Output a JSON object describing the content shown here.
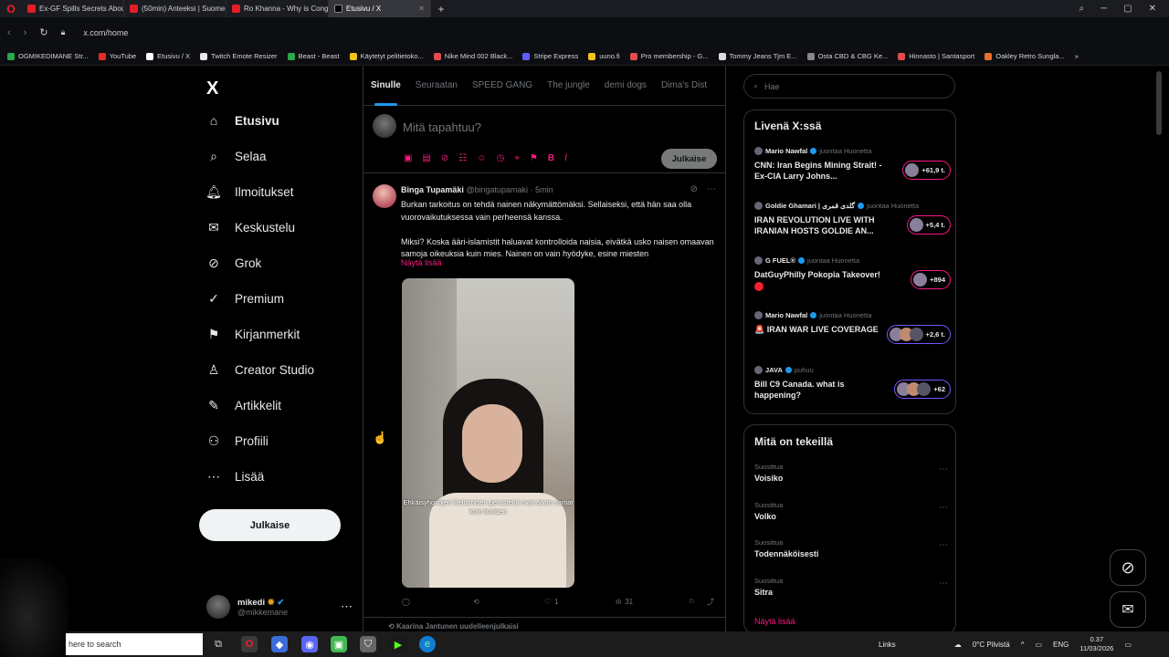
{
  "browser": {
    "tabs": [
      {
        "label": "Ex-GF Spills Secrets About"
      },
      {
        "label": "(50min) Anteeksi | Suome"
      },
      {
        "label": "Ro Khanna - Why is Cong"
      },
      {
        "label": "Etusivu / X"
      }
    ],
    "url": "x.com/home",
    "ai_label": "AI",
    "bookmarks": [
      {
        "label": "OGMIKEDIMANE Str...",
        "color": "#2aa84a"
      },
      {
        "label": "YouTube",
        "color": "#e52d27"
      },
      {
        "label": "Etusivu / X",
        "color": "#ffffff"
      },
      {
        "label": "Twitch Emote Resizer",
        "color": "#e8e8e8"
      },
      {
        "label": "Beast - Beast",
        "color": "#2aa84a"
      },
      {
        "label": "Käytetyt pelitietoko...",
        "color": "#f0c419"
      },
      {
        "label": "Nike Mind 002 Black...",
        "color": "#e54b4b"
      },
      {
        "label": "Stripe Express",
        "color": "#635bff"
      },
      {
        "label": "uuno.fi",
        "color": "#f0c419"
      },
      {
        "label": "Pro membership - G...",
        "color": "#e54b4b"
      },
      {
        "label": "Tommy Jeans Tjm E...",
        "color": "#dddddd"
      },
      {
        "label": "Osta CBD & CBG Ke...",
        "color": "#888888"
      },
      {
        "label": "Hinnasto | Santasport",
        "color": "#e54b4b"
      },
      {
        "label": "Oakley Retro Sungla...",
        "color": "#e8702a"
      }
    ]
  },
  "nav": {
    "logo": "X",
    "items": [
      {
        "label": "Etusivu",
        "icon": "⌂"
      },
      {
        "label": "Selaa",
        "icon": "⌕"
      },
      {
        "label": "Ilmoitukset",
        "icon": "🔔︎"
      },
      {
        "label": "Keskustelu",
        "icon": "✉︎"
      },
      {
        "label": "Grok",
        "icon": "⊘"
      },
      {
        "label": "Premium",
        "icon": "✓"
      },
      {
        "label": "Kirjanmerkit",
        "icon": "⚑"
      },
      {
        "label": "Creator Studio",
        "icon": "♙"
      },
      {
        "label": "Artikkelit",
        "icon": "✎"
      },
      {
        "label": "Profiili",
        "icon": "⚇"
      },
      {
        "label": "Lisää",
        "icon": "⋯"
      }
    ],
    "post_button": "Julkaise",
    "user": {
      "name": "mikedi",
      "handle": "@mikkemane"
    }
  },
  "feed": {
    "tabs": [
      "Sinulle",
      "Seuraatan",
      "SPEED GANG",
      "The jungle",
      "demi dogs",
      "Dima's Dist"
    ],
    "composer": {
      "placeholder": "Mitä tapahtuu?",
      "publish": "Julkaise"
    },
    "tweet": {
      "author": "Binga Tupamäki",
      "handle_time": "@bingatupamaki · 5min",
      "para1": "Burkan tarkoitus on tehdä nainen näkymättömäksi. Sellaiseksi, että hän saa olla vuorovaikutuksessa vain perheensä kanssa.",
      "para2": "Miksi? Koska ääri-islamistit haluavat kontrolloida naisia, eivätkä usko naisen omaavan samoja oikeuksia kuin mies. Nainen on vain hyödyke, esine miesten",
      "show_more": "Näytä lisää",
      "video_caption": "Ehkäisyhoitojen kieltämisen perustelut ovat aivan samat kuin burkien",
      "replies": "",
      "reposts": "",
      "likes": "1",
      "views": "31"
    },
    "next_retweet": "Kaarina Jantunen uudelleenjulkaisi"
  },
  "sidebar": {
    "search_placeholder": "Hae",
    "live_title": "Livenä X:ssä",
    "live": [
      {
        "user": "Mario Nawfal",
        "meta": "juontaa Huonetta",
        "title": "CNN: Iran Begins Mining Strait! - Ex-CIA Larry Johns...",
        "count": "+61,9 t.",
        "ring": "pink"
      },
      {
        "user": "Goldie Ghamari | گلدی قمری",
        "meta": "juontaa Huonetta",
        "title": "IRAN REVOLUTION LIVE WITH IRANIAN HOSTS GOLDIE AN...",
        "count": "+5,4 t.",
        "ring": "pink"
      },
      {
        "user": "G FUEL®",
        "meta": "juontaa Huonetta",
        "title": "DatGuyPhilly Pokopia Takeover!",
        "count": "+894",
        "ring": "pink"
      },
      {
        "user": "Mario Nawfal",
        "meta": "juontaa Huonetta",
        "title": "🚨 IRAN WAR LIVE COVERAGE",
        "count": "+2,6 t.",
        "ring": "purple"
      },
      {
        "user": "JAVA",
        "meta": "puhuu",
        "title": "Bill C9 Canada. what is happening?",
        "count": "+62",
        "ring": "purple"
      }
    ],
    "trends_title": "Mitä on tekeillä",
    "trends": [
      {
        "label": "Suosittua",
        "name": "Voisiko"
      },
      {
        "label": "Suosittua",
        "name": "Volko"
      },
      {
        "label": "Suosittua",
        "name": "Todennäköisesti"
      },
      {
        "label": "Suosittua",
        "name": "Sitra"
      }
    ],
    "show_more": "Näytä lisää"
  },
  "taskbar": {
    "search": "here to search",
    "links": "Links",
    "weather": "0°C  Pilvistä",
    "lang": "ENG",
    "time": "0.37",
    "date": "11/03/2026"
  }
}
